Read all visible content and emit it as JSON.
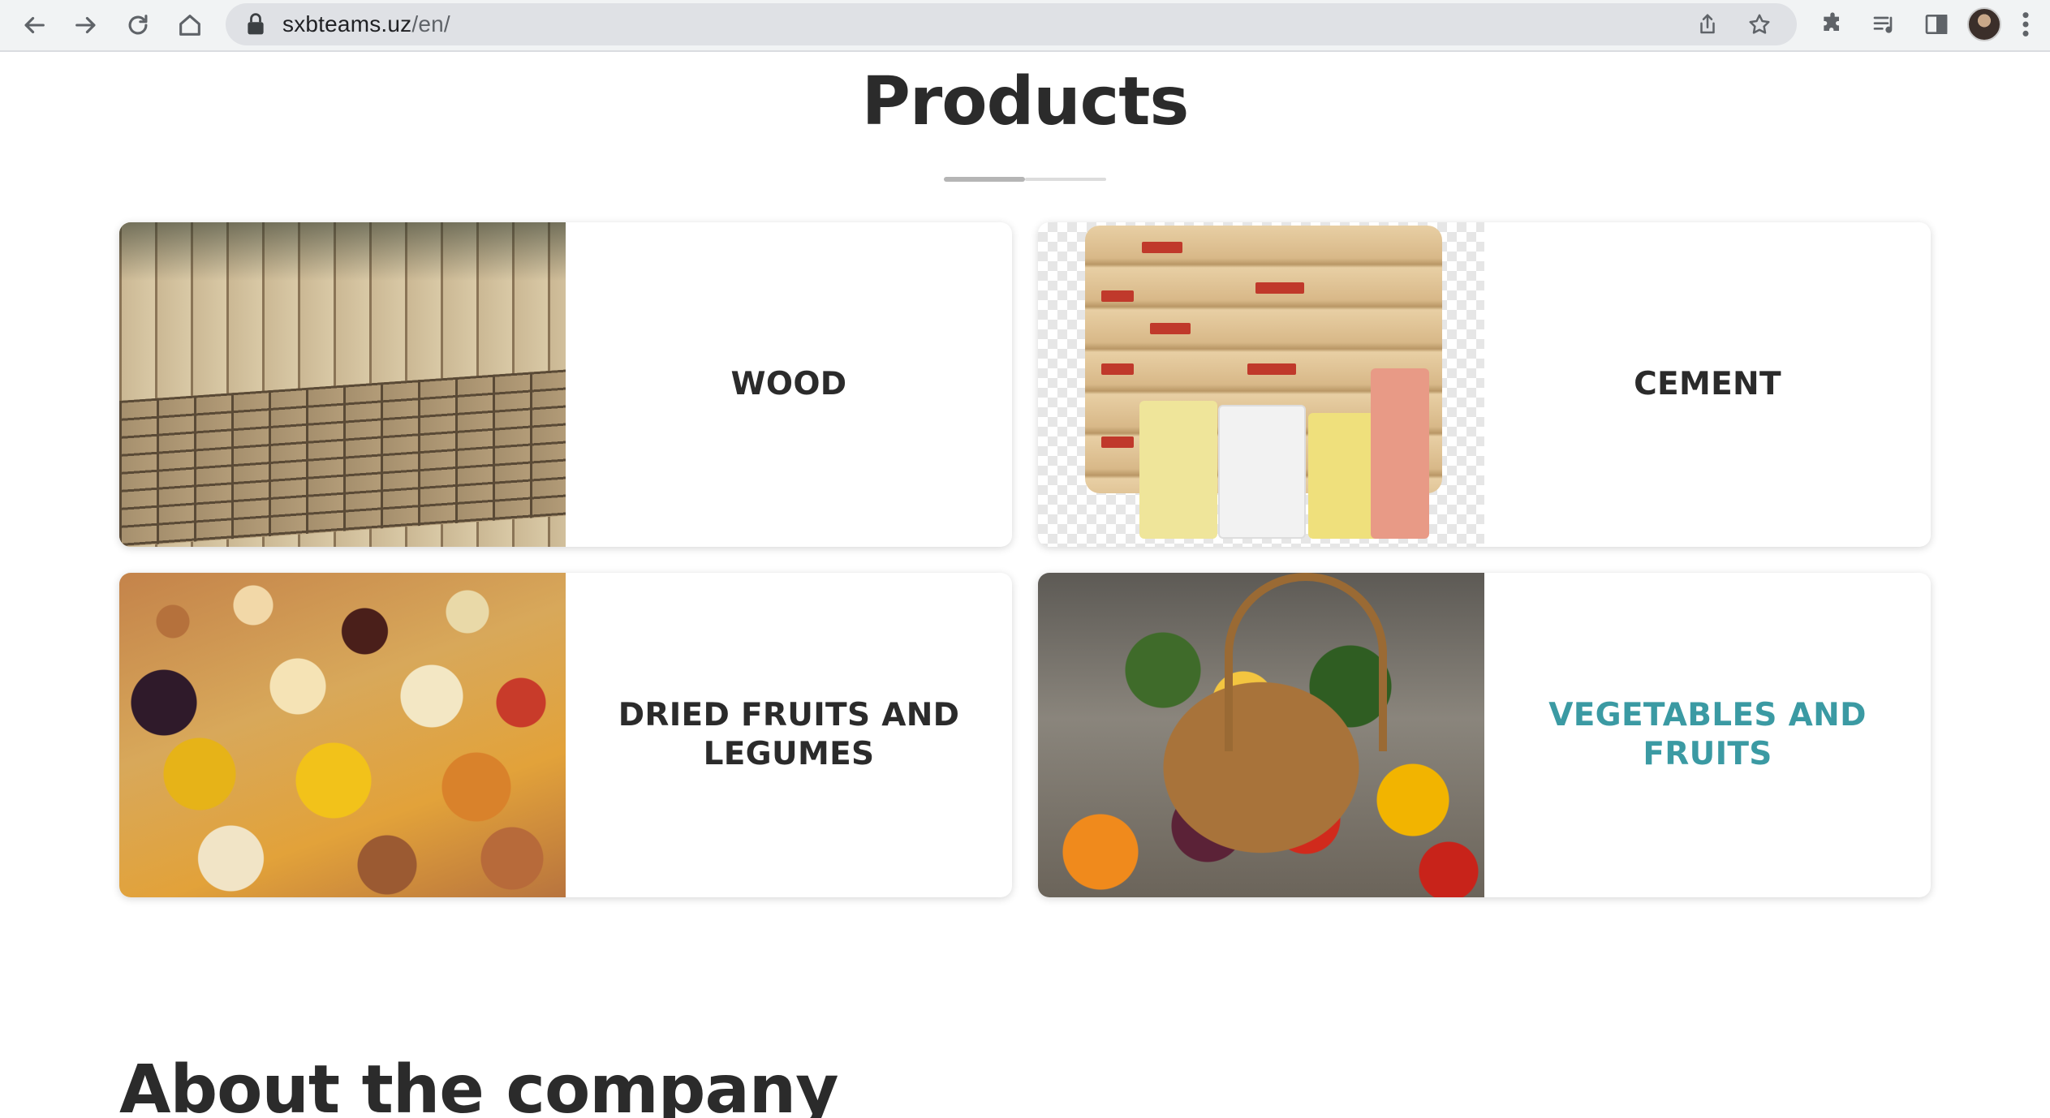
{
  "browser": {
    "url_host": "sxbteams.uz",
    "url_path": "/en/"
  },
  "products": {
    "title": "Products",
    "items": [
      {
        "label": "WOOD"
      },
      {
        "label": "CEMENT"
      },
      {
        "label": "DRIED FRUITS AND LEGUMES"
      },
      {
        "label": "VEGETABLES AND FRUITS"
      }
    ],
    "active_color": "#3b9aa3",
    "text_color": "#2b2b2b"
  },
  "about": {
    "title": "About the company"
  }
}
